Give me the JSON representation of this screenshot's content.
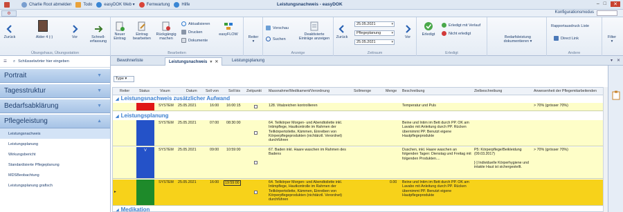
{
  "titlebar": {
    "user_logout": "Charlie Root abmelden",
    "todo": "Todo",
    "easydok_web": "easyDOK Web",
    "fernwartung": "Fernwartung",
    "hilfe": "Hilfe",
    "window_title": "Leistungsnachweis - easyDOK"
  },
  "ribbon_tabs": {
    "konfigurationsmodus": "Konfigurationsmodus"
  },
  "ribbon": {
    "zurueck": "Zurück",
    "resident": "Alder 4  (-)",
    "vor": "Vor",
    "schnellerfassung": "Schnell-\nerfassung",
    "group1": "Übungshaus, Übungsstation",
    "neuer_eintrag": "Neuer\nEintrag",
    "eintrag_bearbeiten": "Eintrag\nbearbeiten",
    "rueckgaengig": "Rückgängig\nmachen",
    "aktualisieren": "Aktualisieren",
    "drucken": "Drucken",
    "dokumente": "Dokumente",
    "easyflow": "easyFLOW",
    "group2": "Bearbeiten",
    "reiter": "Reiter",
    "vorschau": "Vorschau",
    "suchen": "Suchen",
    "deaktivierte": "Deaktivierte\nEinträge anzeigen",
    "group3": "Anzeige",
    "zeitraum_zurueck": "Zurück",
    "date_from": "25.05.2021",
    "plan": "Pflegeplanung",
    "date_to": "25.05.2021",
    "zeitraum_vor": "Vor",
    "group4": "Zeitraum",
    "erledigt": "Erledigt",
    "erledigt_verlauf": "Erledigt mit Verlauf",
    "nicht_erledigt": "Nicht erledigt",
    "group5": "Erledigt",
    "bedarfsleistung": "Bedarfsleistung\ndokumentieren",
    "rapportausdruck": "Rapportausdruck Liste",
    "direct_link": "Direct Link",
    "group6": "Andere",
    "filter": "Filter"
  },
  "sidebar": {
    "search_placeholder": "Schlüsselwörter hier eingeben",
    "sections": [
      "Portrait",
      "Tagesstruktur",
      "Bedarfsabklärung",
      "Pflegeleistung"
    ],
    "subitems": [
      "Leistungsnachweis",
      "Leistungsplanung",
      "Wirkungsbericht",
      "Standardisierte Pflegeplanung",
      "MDSBeobachtung",
      "Leistungsplanung grafisch"
    ]
  },
  "tabs": [
    "Bewohnerliste",
    "Leistungsnachweis",
    "Leistungsplanung"
  ],
  "content": {
    "type_label": "Type",
    "columns": [
      "Reiter",
      "Status",
      "Visum",
      "Datum",
      "Soll von",
      "Soll bis",
      "Zeitpunkt",
      "Massnahme/Medikament/Verordnung",
      "Sollmenge",
      "Menge",
      "Beschreibung",
      "Zielbeschreibung",
      "Anwesenheit der Pflegemitarbeitenden"
    ],
    "group_a": "Leistungsnachweis zusätzlicher Aufwand",
    "group_b": "Leistungsplanung",
    "group_c": "Medikation",
    "rows": [
      {
        "visum": "SYSTEM",
        "datum": "25.05.2021",
        "von": "16:00",
        "bis": "16:00:15",
        "massnahme": "128. Vitalzeichen kontrollieren",
        "sollmenge": "",
        "menge": "",
        "beschreibung": "Temperatur und Puls",
        "ziel": "",
        "anwesenheit": "> 70% (grösser 70%)",
        "status_color": "#e01818",
        "status_text": ""
      },
      {
        "visum": "SYSTEM",
        "datum": "25.05.2021",
        "von": "07:00",
        "bis": "08:30:00",
        "massnahme": "64. Teilkörper Morgen- und Abendtoilette inkl. Intimpflege, Hautkontrolle im Rahmen der Teilkörpertoilette, Kämmen, Einreiben von Körperpflegeprodukten (nichtärztl. Verordnet) durchführen",
        "sollmenge": "",
        "menge": "",
        "beschreibung": "Beine und Intim im Bett durch PP. OK am Lavabo mit Anleitung durch PP. Rücken übernimmt PP. Benutzt eigene Hautpflegeprodukte",
        "ziel": "",
        "anwesenheit": "",
        "status_color": "#2452c8",
        "status_text": ""
      },
      {
        "visum": "SYSTEM",
        "datum": "25.05.2021",
        "von": "09:00",
        "bis": "10:59:00",
        "massnahme": "67. Baden inkl. Haare waschen im Rahmen des Badens",
        "sollmenge": "",
        "menge": "",
        "beschreibung": "Duschen, inkl. Haare waschen an folgenden Tagen: Dienstag und Freitag mit folgenden Produkten....",
        "ziel": "P5: Körperpflege/Beikleidung (09.03.2017)\n\n[-] Individuelle Körperhygiene und intakte Haut ist sichergestellt.",
        "anwesenheit": "> 70% (grösser 70%)",
        "status_color": "#2452c8",
        "status_text": "V"
      },
      {
        "visum": "SYSTEM",
        "datum": "25.05.2021",
        "von": "16:00",
        "bis": "19:59:00",
        "massnahme": "64. Teilkörper Morgen- und Abendtoilette inkl. Intimpflege, Hautkontrolle im Rahmen der Teilkörpertoilette, Kämmen, Einreiben von Körperpflegeprodukten (nichtärztl. Verordnet) durchführen",
        "sollmenge": "",
        "menge": "0.00",
        "beschreibung": "Beine und Intim im Bett durch PP. OK am Lavabo mit Anleitung durch PP. Rücken übernimmt PP. Benutzt eigene Hautpflegeprodukte",
        "ziel": "",
        "anwesenheit": "",
        "status_color": "#1e8a2a",
        "status_text": ""
      }
    ]
  }
}
